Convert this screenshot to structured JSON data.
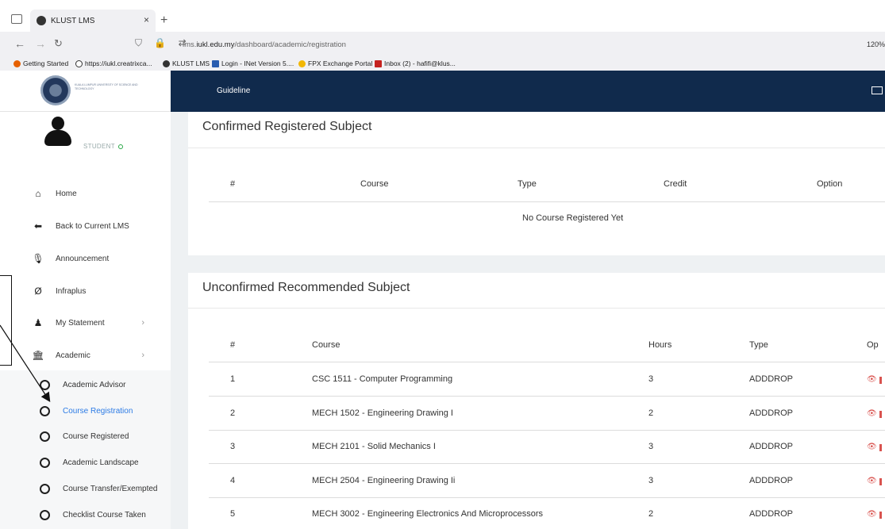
{
  "browser": {
    "tab_title": "KLUST LMS",
    "tab_close": "×",
    "new_tab": "+",
    "url_prefix": "lms.",
    "url_host": "iukl.edu.my",
    "url_path": "/dashboard/academic/registration",
    "zoom": "120%",
    "bookmarks": [
      "Getting Started",
      "https://iukl.creatrixca...",
      "KLUST LMS",
      "Login - INet Version 5....",
      "FPX Exchange Portal",
      "Inbox (2) - hafifi@klus..."
    ]
  },
  "sidebar": {
    "university_text": "KUALA LUMPUR UNIVERSITY OF SCIENCE AND TECHNOLOGY",
    "role": "STUDENT",
    "items": [
      {
        "label": "Home",
        "icon": "home-icon",
        "glyph": "⌂"
      },
      {
        "label": "Back to Current LMS",
        "icon": "arrow-left-icon",
        "glyph": "⬅"
      },
      {
        "label": "Announcement",
        "icon": "microphone-icon",
        "glyph": "🎙"
      },
      {
        "label": "Infraplus",
        "icon": "infraplus-icon",
        "glyph": "Ø"
      },
      {
        "label": "My Statement",
        "icon": "user-icon",
        "glyph": "♟"
      },
      {
        "label": "Academic",
        "icon": "university-icon",
        "glyph": "🏛"
      }
    ],
    "sub_items": [
      "Academic Advisor",
      "Course Registration",
      "Course Registered",
      "Academic Landscape",
      "Course Transfer/Exempted",
      "Checklist Course Taken"
    ]
  },
  "topnav": {
    "guideline": "Guideline"
  },
  "confirmed": {
    "title": "Confirmed Registered Subject",
    "headers": [
      "#",
      "Course",
      "Type",
      "Credit",
      "Option"
    ],
    "empty": "No Course Registered Yet"
  },
  "unconfirmed": {
    "title": "Unconfirmed Recommended Subject",
    "headers": [
      "#",
      "Course",
      "Hours",
      "Type",
      "Op"
    ],
    "rows": [
      {
        "no": "1",
        "course": "CSC 1511 - Computer Programming",
        "hours": "3",
        "type": "ADDDROP"
      },
      {
        "no": "2",
        "course": "MECH 1502 - Engineering Drawing I",
        "hours": "2",
        "type": "ADDDROP"
      },
      {
        "no": "3",
        "course": "MECH 2101 - Solid Mechanics I",
        "hours": "3",
        "type": "ADDDROP"
      },
      {
        "no": "4",
        "course": "MECH 2504 - Engineering Drawing Ii",
        "hours": "3",
        "type": "ADDDROP"
      },
      {
        "no": "5",
        "course": "MECH 3002 - Engineering Electronics And Microprocessors",
        "hours": "2",
        "type": "ADDDROP"
      }
    ]
  },
  "colors": {
    "navbar": "#102a4c",
    "active_link": "#2c7be5",
    "online": "#28a745",
    "action_red": "#d9534f"
  }
}
